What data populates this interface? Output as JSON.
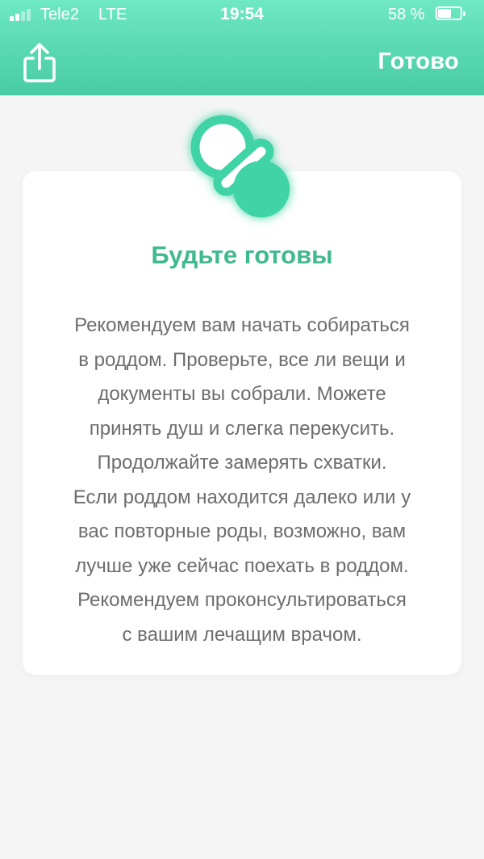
{
  "status_bar": {
    "carrier": "Tele2",
    "network": "LTE",
    "time": "19:54",
    "battery_percent": "58 %",
    "battery_level": 0.58,
    "signal_bars_active": 2,
    "signal_bars_total": 4
  },
  "header": {
    "share_icon": "share-icon",
    "done_label": "Готово"
  },
  "card": {
    "icon": "pacifier-icon",
    "title": "Будьте готовы",
    "body_lines": [
      "Рекомендуем вам начать собираться",
      "в роддом. Проверьте, все ли вещи и",
      "документы вы собрали. Можете",
      "принять душ и слегка перекусить.",
      "Продолжайте замерять схватки.",
      "Если роддом находится далеко или у",
      "вас повторные роды, возможно, вам",
      "лучше уже сейчас поехать в роддом.",
      "Рекомендуем проконсультироваться",
      "с вашим лечащим врачом."
    ]
  },
  "colors": {
    "header_gradient_top": "#6fe9c3",
    "header_gradient_bottom": "#48cba3",
    "accent": "#3fb98e",
    "icon_green": "#3fd3a5",
    "background": "#f5f5f5",
    "text": "#6d6d6d"
  }
}
